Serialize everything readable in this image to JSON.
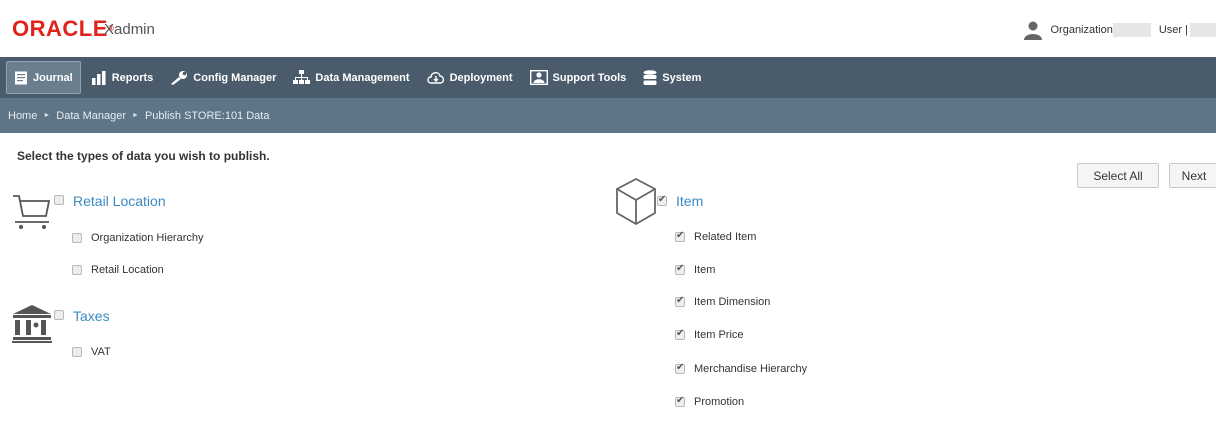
{
  "header": {
    "logo": "ORACLE",
    "logo_mark": "®",
    "app_name": "Xadmin",
    "organization_label": "Organization",
    "user_label": "User |"
  },
  "nav": {
    "items": [
      {
        "label": "Journal",
        "icon": "journal-icon"
      },
      {
        "label": "Reports",
        "icon": "bar-chart-icon"
      },
      {
        "label": "Config Manager",
        "icon": "wrench-icon"
      },
      {
        "label": "Data Management",
        "icon": "hierarchy-icon"
      },
      {
        "label": "Deployment",
        "icon": "cloud-download-icon"
      },
      {
        "label": "Support Tools",
        "icon": "support-person-icon"
      },
      {
        "label": "System",
        "icon": "database-icon"
      }
    ],
    "active": "Journal"
  },
  "breadcrumb": [
    "Home",
    "Data Manager",
    "Publish STORE:101 Data"
  ],
  "breadcrumb_separator": "►",
  "main": {
    "instruction": "Select the types of data you wish to publish.",
    "select_all_label": "Select All",
    "next_label": "Next",
    "groups": [
      {
        "title": "Retail Location",
        "icon": "shopping-cart-icon",
        "checked": false,
        "items": [
          {
            "label": "Organization Hierarchy",
            "checked": false
          },
          {
            "label": "Retail Location",
            "checked": false
          }
        ]
      },
      {
        "title": "Taxes",
        "icon": "bank-building-icon",
        "checked": false,
        "items": [
          {
            "label": "VAT",
            "checked": false
          }
        ]
      },
      {
        "title": "Item",
        "icon": "cube-icon",
        "checked": true,
        "items": [
          {
            "label": "Related Item",
            "checked": true
          },
          {
            "label": "Item",
            "checked": true
          },
          {
            "label": "Item Dimension",
            "checked": true
          },
          {
            "label": "Item Price",
            "checked": true
          },
          {
            "label": "Merchandise Hierarchy",
            "checked": true
          },
          {
            "label": "Promotion",
            "checked": true
          }
        ]
      }
    ]
  },
  "colors": {
    "brand_red": "#e2231a",
    "nav_bg": "#4a5c6b",
    "breadcrumb_bg": "#5e7487",
    "group_title": "#3b8ac4"
  }
}
